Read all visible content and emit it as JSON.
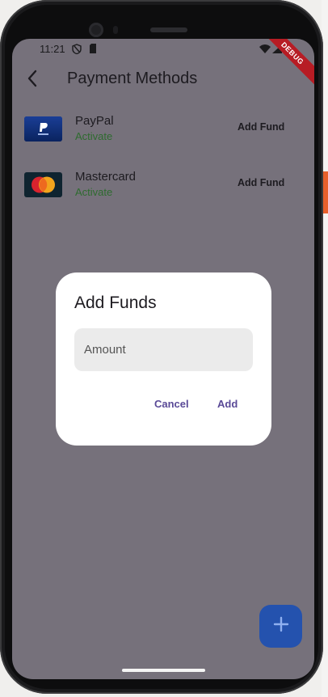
{
  "status_bar": {
    "time": "11:21"
  },
  "debug_banner": "DEBUG",
  "app_bar": {
    "title": "Payment Methods"
  },
  "payment_methods": [
    {
      "name": "PayPal",
      "status": "Activate",
      "action": "Add Fund",
      "logo": "paypal-logo"
    },
    {
      "name": "Mastercard",
      "status": "Activate",
      "action": "Add Fund",
      "logo": "mastercard-logo"
    }
  ],
  "dialog": {
    "title": "Add Funds",
    "amount_placeholder": "Amount",
    "amount_value": "",
    "cancel_label": "Cancel",
    "add_label": "Add"
  },
  "fab": {
    "icon": "plus-icon"
  },
  "colors": {
    "scrim": "#76717b",
    "accent": "#2452ae",
    "status_green": "#2e6b2f",
    "dialog_button": "#5a4a97"
  }
}
